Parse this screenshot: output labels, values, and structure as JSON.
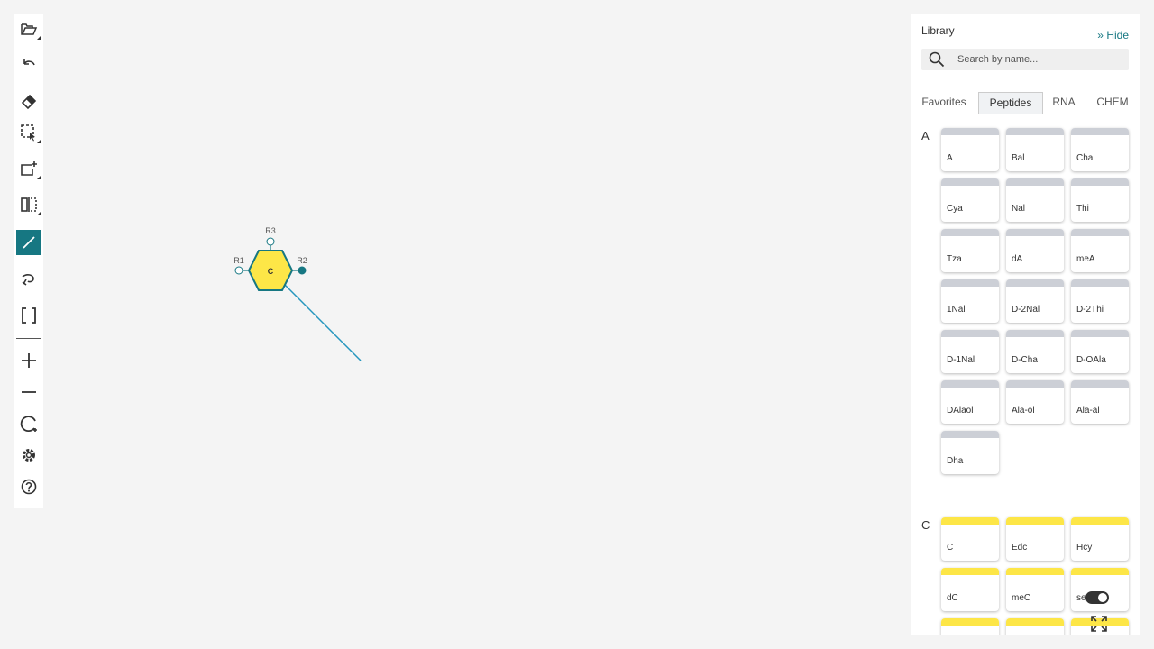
{
  "toolbar": {
    "tools": [
      {
        "name": "open-file-tool",
        "icon": "folder-open-icon"
      },
      {
        "name": "undo-tool",
        "icon": "undo-icon"
      },
      {
        "name": "erase-tool",
        "icon": "eraser-icon"
      },
      {
        "name": "select-tool",
        "icon": "lasso-select-icon"
      },
      {
        "name": "create-tool",
        "icon": "add-rectangle-icon"
      },
      {
        "name": "flip-tool",
        "icon": "flip-icon"
      },
      {
        "name": "single-bond-tool",
        "icon": "bond-line-icon",
        "active": true
      },
      {
        "name": "antisense-tool",
        "icon": "antisense-icon"
      },
      {
        "name": "brackets-tool",
        "icon": "brackets-icon"
      },
      {
        "name": "zoom-in-tool",
        "icon": "plus-icon"
      },
      {
        "name": "zoom-out-tool",
        "icon": "minus-icon"
      },
      {
        "name": "reset-zoom-tool",
        "icon": "reset-icon"
      },
      {
        "name": "settings-tool",
        "icon": "gear-icon"
      },
      {
        "name": "help-tool",
        "icon": "help-icon"
      }
    ],
    "accent": "#167782"
  },
  "canvas": {
    "monomer": {
      "label": "C",
      "fill": "#fde647",
      "stroke": "#167782",
      "attachment_points": {
        "r1": "R1",
        "r2": "R2",
        "r3": "R3"
      }
    }
  },
  "library": {
    "title": "Library",
    "hide_label": "Hide",
    "search_placeholder": "Search by name...",
    "tabs": [
      "Favorites",
      "Peptides",
      "RNA",
      "CHEM"
    ],
    "active_tab": "Peptides",
    "groups": [
      {
        "letter": "A",
        "color": "#cccfd6",
        "items": [
          "A",
          "Bal",
          "Cha",
          "Cya",
          "Nal",
          "Thi",
          "Tza",
          "dA",
          "meA",
          "1Nal",
          "D-2Nal",
          "D-2Thi",
          "D-1Nal",
          "D-Cha",
          "D-OAla",
          "DAlaol",
          "Ala-ol",
          "Ala-al",
          "Dha"
        ]
      },
      {
        "letter": "C",
        "color": "#fde647",
        "items": [
          "C",
          "Edc",
          "Hcy",
          "dC",
          "meC",
          "se"
        ]
      }
    ]
  }
}
